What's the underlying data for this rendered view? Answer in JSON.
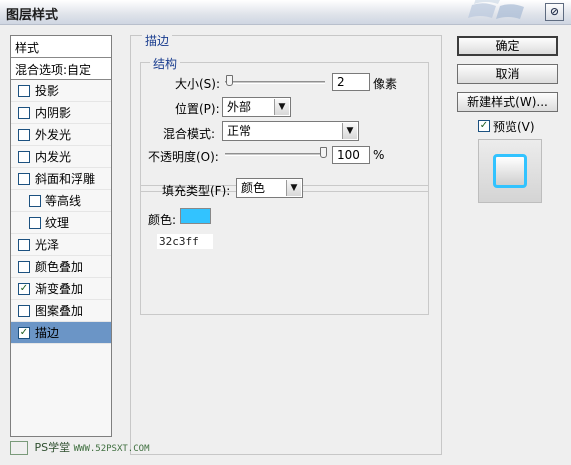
{
  "window": {
    "title": "图层样式",
    "close_glyph": "⊘"
  },
  "style_list": {
    "header": "样式",
    "blend_options": "混合选项:自定",
    "items": [
      {
        "label": "投影",
        "checked": false,
        "indent": false,
        "selected": false
      },
      {
        "label": "内阴影",
        "checked": false,
        "indent": false,
        "selected": false
      },
      {
        "label": "外发光",
        "checked": false,
        "indent": false,
        "selected": false
      },
      {
        "label": "内发光",
        "checked": false,
        "indent": false,
        "selected": false
      },
      {
        "label": "斜面和浮雕",
        "checked": false,
        "indent": false,
        "selected": false
      },
      {
        "label": "等高线",
        "checked": false,
        "indent": true,
        "selected": false
      },
      {
        "label": "纹理",
        "checked": false,
        "indent": true,
        "selected": false
      },
      {
        "label": "光泽",
        "checked": false,
        "indent": false,
        "selected": false
      },
      {
        "label": "颜色叠加",
        "checked": false,
        "indent": false,
        "selected": false
      },
      {
        "label": "渐变叠加",
        "checked": true,
        "indent": false,
        "selected": false
      },
      {
        "label": "图案叠加",
        "checked": false,
        "indent": false,
        "selected": false
      },
      {
        "label": "描边",
        "checked": true,
        "indent": false,
        "selected": true
      }
    ]
  },
  "stroke_panel": {
    "title": "描边",
    "structure": {
      "title": "结构",
      "size_label": "大小(S):",
      "size_value": "2",
      "size_unit": "像素",
      "size_level": 0.04,
      "position_label": "位置(P):",
      "position_value": "外部",
      "blend_mode_label": "混合模式:",
      "blend_mode_value": "正常",
      "opacity_label": "不透明度(O):",
      "opacity_value": "100",
      "opacity_unit": "%",
      "opacity_level": 1.0
    },
    "fill": {
      "type_label": "填充类型(F):",
      "type_value": "颜色",
      "color_label": "颜色:",
      "color_hex": "32c3ff",
      "color_value": "#32c3ff"
    }
  },
  "buttons": {
    "ok": "确定",
    "cancel": "取消",
    "new_style": "新建样式(W)...",
    "preview_label": "预览(V)",
    "preview_checked": true
  },
  "watermark": {
    "brand": "PS学堂",
    "url": "WWW.52PSXT.COM"
  }
}
